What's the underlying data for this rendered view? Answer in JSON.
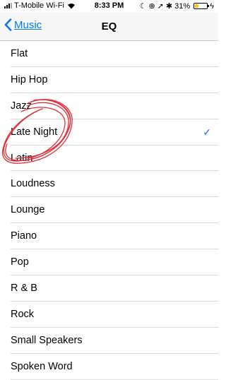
{
  "status_bar": {
    "carrier": "T-Mobile Wi-Fi",
    "time": "8:33 PM",
    "battery_percent": "31%",
    "battery_level": 0.31,
    "battery_color": "#f5c518"
  },
  "nav": {
    "back_label": "Music",
    "title": "EQ",
    "accent_color": "#007aff"
  },
  "eq_presets": {
    "items": [
      {
        "label": "Flat",
        "selected": false
      },
      {
        "label": "Hip Hop",
        "selected": false
      },
      {
        "label": "Jazz",
        "selected": false
      },
      {
        "label": "Late Night",
        "selected": true
      },
      {
        "label": "Latin",
        "selected": false
      },
      {
        "label": "Loudness",
        "selected": false
      },
      {
        "label": "Lounge",
        "selected": false
      },
      {
        "label": "Piano",
        "selected": false
      },
      {
        "label": "Pop",
        "selected": false
      },
      {
        "label": "R & B",
        "selected": false
      },
      {
        "label": "Rock",
        "selected": false
      },
      {
        "label": "Small Speakers",
        "selected": false
      },
      {
        "label": "Spoken Word",
        "selected": false
      }
    ],
    "checkmark": "✓"
  },
  "annotation": {
    "ink_color": "#e0303a"
  }
}
